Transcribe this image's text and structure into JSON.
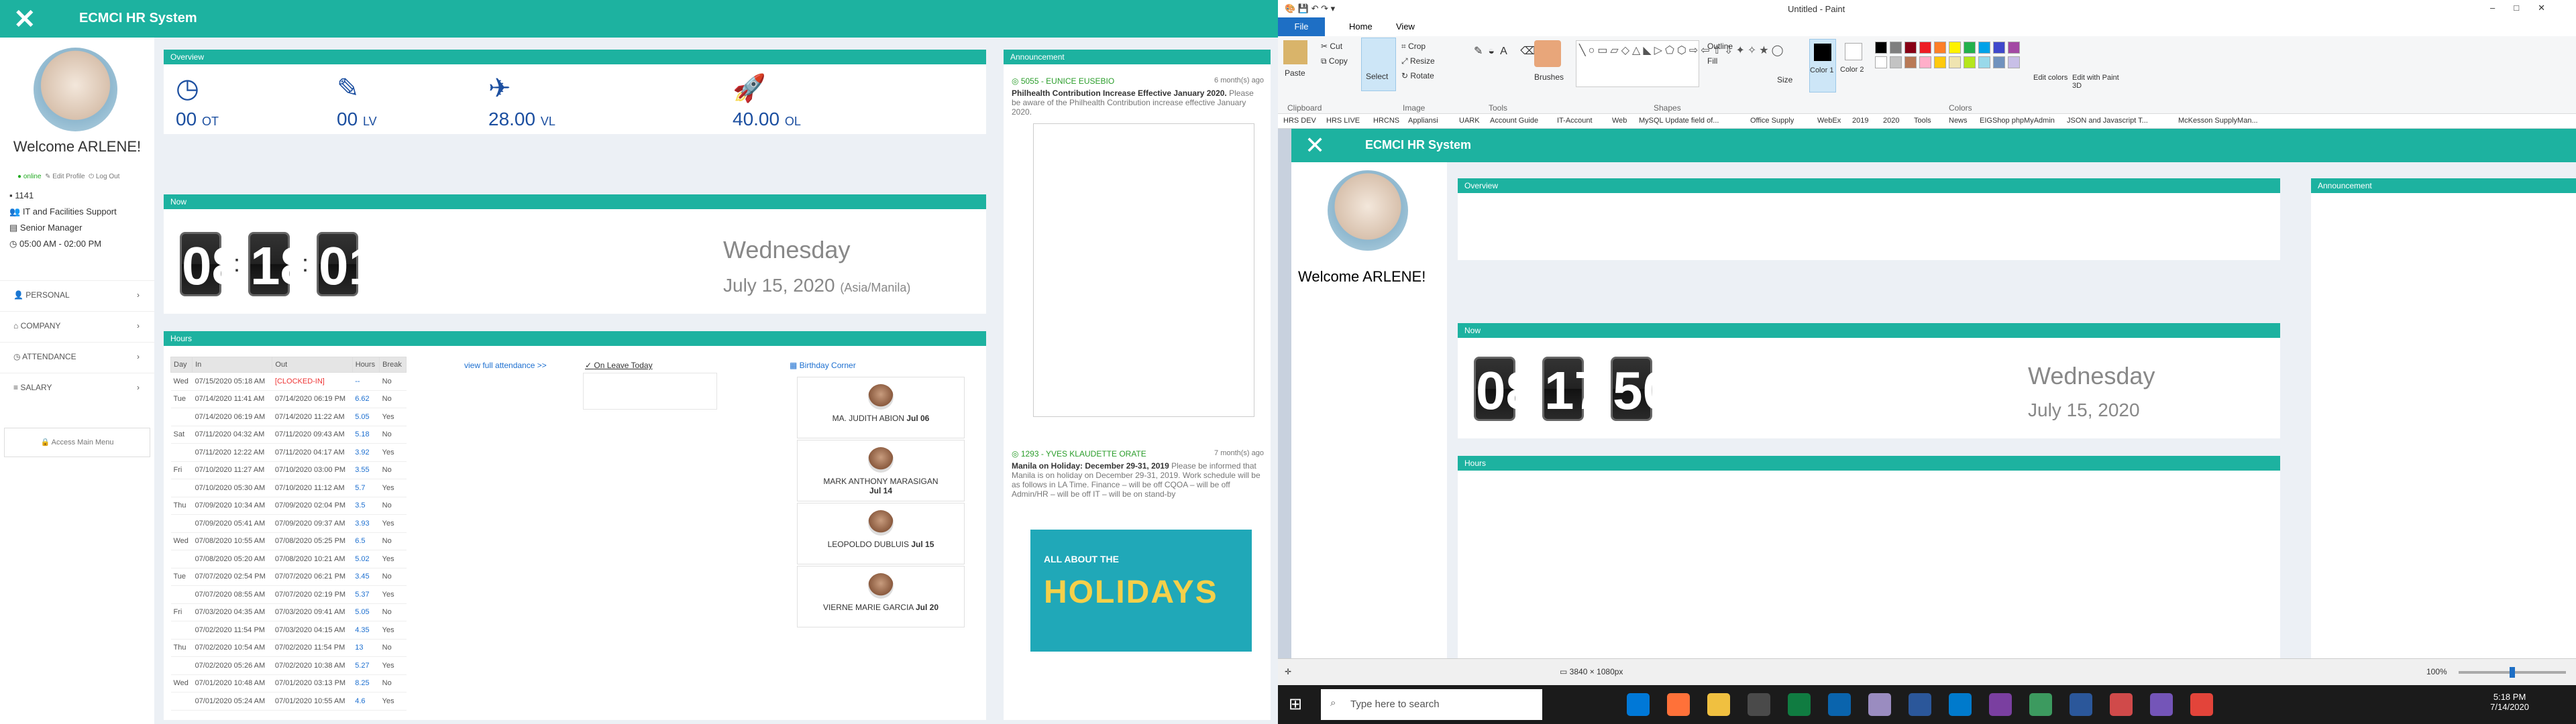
{
  "app": {
    "close_icon": "close-icon",
    "title": "ECMCI HR System"
  },
  "user": {
    "welcome": "Welcome ARLENE!",
    "status_online": "online",
    "edit_profile": "Edit Profile",
    "logout": "Log Out",
    "id": "1141",
    "department": "IT and Facilities Support",
    "position": "Senior Manager",
    "shift": "05:00 AM - 02:00 PM"
  },
  "menu": [
    {
      "label": "PERSONAL"
    },
    {
      "label": "COMPANY"
    },
    {
      "label": "ATTENDANCE"
    },
    {
      "label": "SALARY"
    }
  ],
  "access_menu": "Access Main Menu",
  "overview": {
    "title": "Overview",
    "stats": [
      {
        "icon": "clock-icon",
        "value": "00",
        "unit": "OT"
      },
      {
        "icon": "edit-icon",
        "value": "00",
        "unit": "LV"
      },
      {
        "icon": "plane-icon",
        "value": "28.00",
        "unit": "VL"
      },
      {
        "icon": "rocket-icon",
        "value": "40.00",
        "unit": "OL"
      }
    ]
  },
  "now": {
    "title": "Now",
    "hh": "08",
    "mm": "18",
    "ss": "01",
    "weekday": "Wednesday",
    "date": "July 15, 2020",
    "tz": "(Asia/Manila)"
  },
  "hours": {
    "title": "Hours",
    "headers": [
      "Day",
      "In",
      "Out",
      "Hours",
      "Break"
    ],
    "rows": [
      [
        "Wed",
        "07/15/2020 05:18 AM",
        "[CLOCKED-IN]",
        "--",
        "No"
      ],
      [
        "Tue",
        "07/14/2020 11:41 AM",
        "07/14/2020 06:19 PM",
        "6.62",
        "No"
      ],
      [
        "",
        "07/14/2020 06:19 AM",
        "07/14/2020 11:22 AM",
        "5.05",
        "Yes"
      ],
      [
        "Sat",
        "07/11/2020 04:32 AM",
        "07/11/2020 09:43 AM",
        "5.18",
        "No"
      ],
      [
        "",
        "07/11/2020 12:22 AM",
        "07/11/2020 04:17 AM",
        "3.92",
        "Yes"
      ],
      [
        "Fri",
        "07/10/2020 11:27 AM",
        "07/10/2020 03:00 PM",
        "3.55",
        "No"
      ],
      [
        "",
        "07/10/2020 05:30 AM",
        "07/10/2020 11:12 AM",
        "5.7",
        "Yes"
      ],
      [
        "Thu",
        "07/09/2020 10:34 AM",
        "07/09/2020 02:04 PM",
        "3.5",
        "No"
      ],
      [
        "",
        "07/09/2020 05:41 AM",
        "07/09/2020 09:37 AM",
        "3.93",
        "Yes"
      ],
      [
        "Wed",
        "07/08/2020 10:55 AM",
        "07/08/2020 05:25 PM",
        "6.5",
        "No"
      ],
      [
        "",
        "07/08/2020 05:20 AM",
        "07/08/2020 10:21 AM",
        "5.02",
        "Yes"
      ],
      [
        "Tue",
        "07/07/2020 02:54 PM",
        "07/07/2020 06:21 PM",
        "3.45",
        "No"
      ],
      [
        "",
        "07/07/2020 08:55 AM",
        "07/07/2020 02:19 PM",
        "5.37",
        "Yes"
      ],
      [
        "Fri",
        "07/03/2020 04:35 AM",
        "07/03/2020 09:41 AM",
        "5.05",
        "No"
      ],
      [
        "",
        "07/02/2020 11:54 PM",
        "07/03/2020 04:15 AM",
        "4.35",
        "Yes"
      ],
      [
        "Thu",
        "07/02/2020 10:54 AM",
        "07/02/2020 11:54 PM",
        "13",
        "No"
      ],
      [
        "",
        "07/02/2020 05:26 AM",
        "07/02/2020 10:38 AM",
        "5.27",
        "Yes"
      ],
      [
        "Wed",
        "07/01/2020 10:48 AM",
        "07/01/2020 03:13 PM",
        "8.25",
        "No"
      ],
      [
        "",
        "07/01/2020 05:24 AM",
        "07/01/2020 10:55 AM",
        "4.6",
        "Yes"
      ]
    ]
  },
  "links": {
    "view_attendance": "view full attendance >>",
    "on_leave": "On Leave Today",
    "birthday": "Birthday Corner"
  },
  "birthdays": [
    {
      "name": "MA. JUDITH ABION",
      "date": "Jul 06"
    },
    {
      "name": "MARK ANTHONY MARASIGAN",
      "date": "Jul 14"
    },
    {
      "name": "LEOPOLDO DUBLUIS",
      "date": "Jul 15"
    },
    {
      "name": "VIERNE MARIE GARCIA",
      "date": "Jul 20"
    }
  ],
  "announcement": {
    "title": "Announcement",
    "items": [
      {
        "author": "5055 - EUNICE EUSEBIO",
        "ago": "6 month(s) ago",
        "headline": "Philhealth Contribution Increase Effective January 2020.",
        "body": "Please be aware of the Philhealth Contribution increase effective January 2020."
      },
      {
        "author": "1293 - YVES KLAUDETTE ORATE",
        "ago": "7 month(s) ago",
        "headline": "Manila on Holiday: December 29-31, 2019",
        "body": "Please be informed that Manila is on holiday on December 29-31, 2019. Work schedule will be as follows in LA Time. Finance – will be off CQOA – will be off Admin/HR – will be off IT – will be on stand-by"
      }
    ]
  },
  "holiday_banner": {
    "line1": "ALL ABOUT THE",
    "line2": "HOLIDAYS"
  },
  "paint": {
    "window_title": "Untitled - Paint",
    "tabs": [
      "File",
      "Home",
      "View"
    ],
    "groups": [
      "Clipboard",
      "Image",
      "Tools",
      "Shapes",
      "Colors"
    ],
    "buttons": {
      "paste": "Paste",
      "cut": "Cut",
      "copy": "Copy",
      "select": "Select",
      "crop": "Crop",
      "resize": "Resize",
      "rotate": "Rotate",
      "brushes": "Brushes",
      "outline": "Outline",
      "fill": "Fill",
      "size": "Size",
      "color1": "Color 1",
      "color2": "Color 2",
      "edit_colors": "Edit colors",
      "edit_paint3d": "Edit with Paint 3D"
    },
    "palette": [
      "#000000",
      "#7f7f7f",
      "#880015",
      "#ed1c24",
      "#ff7f27",
      "#fff200",
      "#22b14c",
      "#00a2e8",
      "#3f48cc",
      "#a349a4",
      "#ffffff",
      "#c3c3c3",
      "#b97a57",
      "#ffaec9",
      "#ffc90e",
      "#efe4b0",
      "#b5e61d",
      "#99d9ea",
      "#7092be",
      "#c8bfe7"
    ],
    "canvas_size": "3840 × 1080px",
    "zoom": "100%"
  },
  "bookmarks": [
    "HRS DEV",
    "HRS LIVE",
    "HRCNS",
    "Appliansi",
    "UARK",
    "Account Guide",
    "IT-Account",
    "Web",
    "MySQL Update field of...",
    "Office Supply",
    "WebEx",
    "2019",
    "2020",
    "Tools",
    "News",
    "EIGShop phpMyAdmin",
    "JSON and Javascript T...",
    "McKesson SupplyMan..."
  ],
  "right_capture": {
    "clock_hh": "08",
    "clock_mm": "17",
    "clock_ss": "50"
  },
  "taskbar": {
    "search": "Type here to search",
    "time": "5:18 PM",
    "date": "7/14/2020"
  }
}
